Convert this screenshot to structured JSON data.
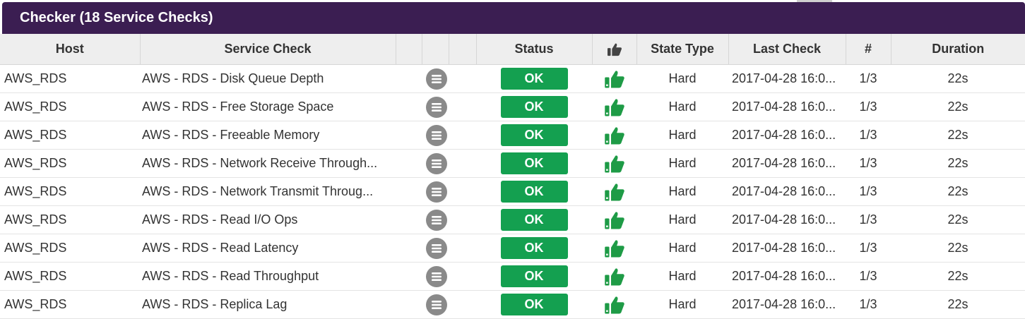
{
  "panel": {
    "title": "Checker (18 Service Checks)"
  },
  "columns": {
    "host": "Host",
    "service": "Service Check",
    "status": "Status",
    "ack_icon": "thumbs-up-icon",
    "state_type": "State Type",
    "last_check": "Last Check",
    "attempt": "#",
    "duration": "Duration"
  },
  "colors": {
    "header_bar": "#3b1e52",
    "ok": "#14a050",
    "thumb": "#1e9b46",
    "info_icon": "#8a8a8a"
  },
  "rows": [
    {
      "host": "AWS_RDS",
      "service": "AWS - RDS - Disk Queue Depth",
      "status": "OK",
      "state_type": "Hard",
      "last_check": "2017-04-28 16:0...",
      "attempt": "1/3",
      "duration": "22s"
    },
    {
      "host": "AWS_RDS",
      "service": "AWS - RDS - Free Storage Space",
      "status": "OK",
      "state_type": "Hard",
      "last_check": "2017-04-28 16:0...",
      "attempt": "1/3",
      "duration": "22s"
    },
    {
      "host": "AWS_RDS",
      "service": "AWS - RDS - Freeable Memory",
      "status": "OK",
      "state_type": "Hard",
      "last_check": "2017-04-28 16:0...",
      "attempt": "1/3",
      "duration": "22s"
    },
    {
      "host": "AWS_RDS",
      "service": "AWS - RDS - Network Receive Through...",
      "status": "OK",
      "state_type": "Hard",
      "last_check": "2017-04-28 16:0...",
      "attempt": "1/3",
      "duration": "22s"
    },
    {
      "host": "AWS_RDS",
      "service": "AWS - RDS - Network Transmit Throug...",
      "status": "OK",
      "state_type": "Hard",
      "last_check": "2017-04-28 16:0...",
      "attempt": "1/3",
      "duration": "22s"
    },
    {
      "host": "AWS_RDS",
      "service": "AWS - RDS - Read I/O Ops",
      "status": "OK",
      "state_type": "Hard",
      "last_check": "2017-04-28 16:0...",
      "attempt": "1/3",
      "duration": "22s"
    },
    {
      "host": "AWS_RDS",
      "service": "AWS - RDS - Read Latency",
      "status": "OK",
      "state_type": "Hard",
      "last_check": "2017-04-28 16:0...",
      "attempt": "1/3",
      "duration": "22s"
    },
    {
      "host": "AWS_RDS",
      "service": "AWS - RDS - Read Throughput",
      "status": "OK",
      "state_type": "Hard",
      "last_check": "2017-04-28 16:0...",
      "attempt": "1/3",
      "duration": "22s"
    },
    {
      "host": "AWS_RDS",
      "service": "AWS - RDS - Replica Lag",
      "status": "OK",
      "state_type": "Hard",
      "last_check": "2017-04-28 16:0...",
      "attempt": "1/3",
      "duration": "22s"
    }
  ]
}
